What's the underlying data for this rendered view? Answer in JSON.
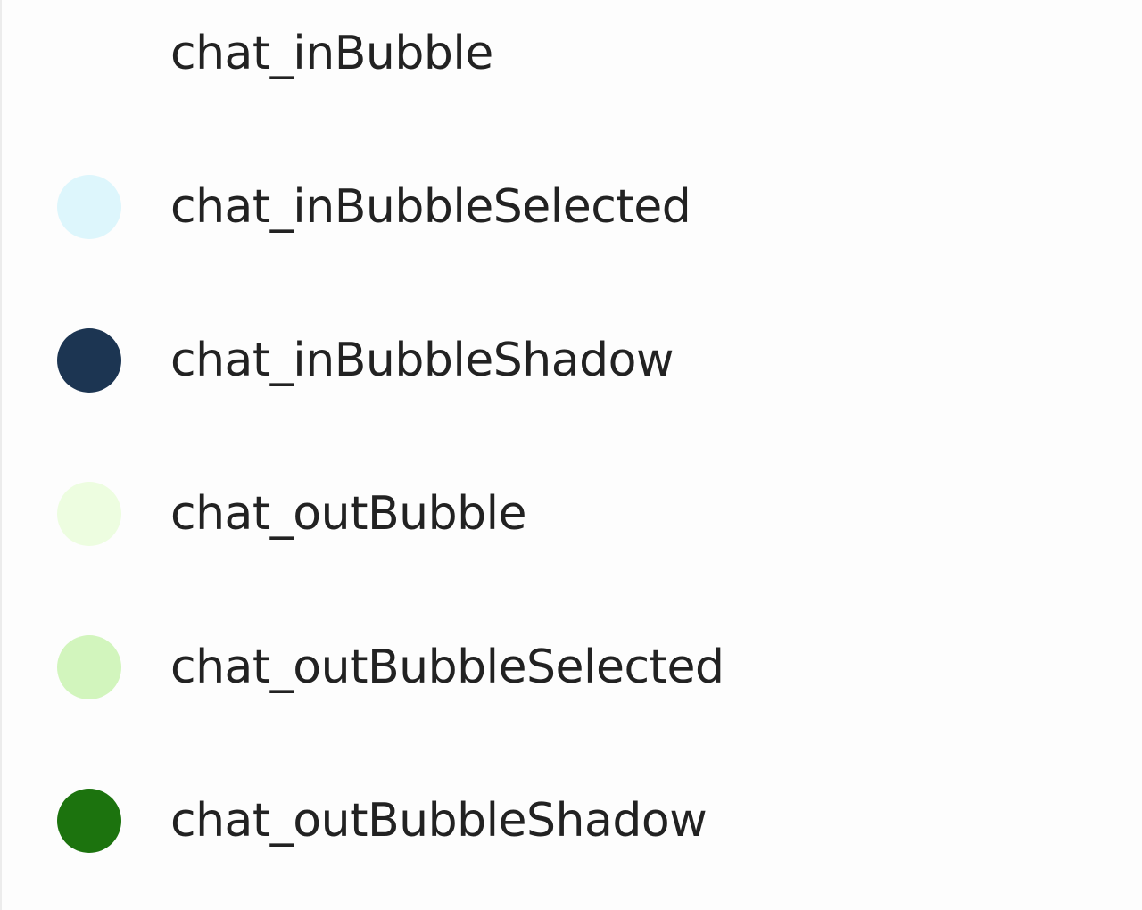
{
  "theme_colors": [
    {
      "key": "chat_inBubble",
      "color": "#fdfdfd"
    },
    {
      "key": "chat_inBubbleSelected",
      "color": "#ddf6fc"
    },
    {
      "key": "chat_inBubbleShadow",
      "color": "#1c3552"
    },
    {
      "key": "chat_outBubble",
      "color": "#edfde0"
    },
    {
      "key": "chat_outBubbleSelected",
      "color": "#d2f5bd"
    },
    {
      "key": "chat_outBubbleShadow",
      "color": "#1c730e"
    }
  ]
}
